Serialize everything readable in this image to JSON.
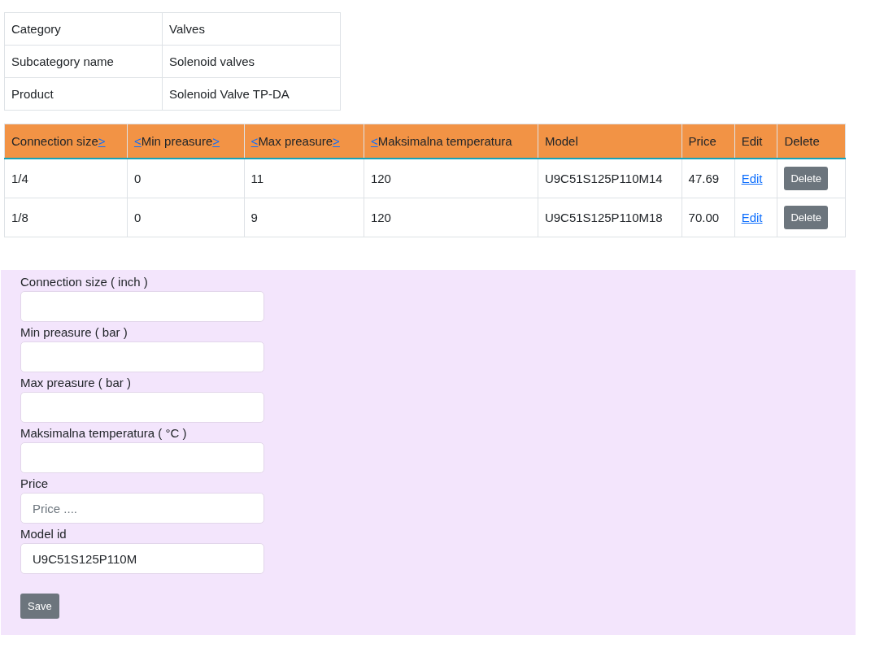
{
  "info_table": [
    {
      "label": "Category",
      "value": "Valves"
    },
    {
      "label": "Subcategory name",
      "value": "Solenoid valves"
    },
    {
      "label": "Product",
      "value": "Solenoid Valve TP-DA"
    }
  ],
  "products_table": {
    "columns": [
      {
        "label": "Connection size",
        "sort_next": ">"
      },
      {
        "label": "Min preasure",
        "sort_prev": "<",
        "sort_next": ">"
      },
      {
        "label": "Max preasure",
        "sort_prev": "<",
        "sort_next": ">"
      },
      {
        "label": "Maksimalna temperatura",
        "sort_prev": "<"
      },
      {
        "label": "Model"
      },
      {
        "label": "Price"
      },
      {
        "label": "Edit"
      },
      {
        "label": "Delete"
      }
    ],
    "rows": [
      {
        "cells": [
          "1/4",
          "0",
          "11",
          "120",
          "U9C51S125P110M14",
          "47.69"
        ],
        "edit": "Edit",
        "delete": "Delete"
      },
      {
        "cells": [
          "1/8",
          "0",
          "9",
          "120",
          "U9C51S125P110M18",
          "70.00"
        ],
        "edit": "Edit",
        "delete": "Delete"
      }
    ]
  },
  "form": {
    "fields": [
      {
        "label": "Connection size ( inch )"
      },
      {
        "label": "Min preasure ( bar )"
      },
      {
        "label": "Max preasure ( bar )"
      },
      {
        "label": "Maksimalna temperatura ( °C )"
      },
      {
        "label": "Price",
        "placeholder": "Price ...."
      },
      {
        "label": "Model id",
        "value": "U9C51S125P110M"
      }
    ],
    "save": "Save"
  }
}
